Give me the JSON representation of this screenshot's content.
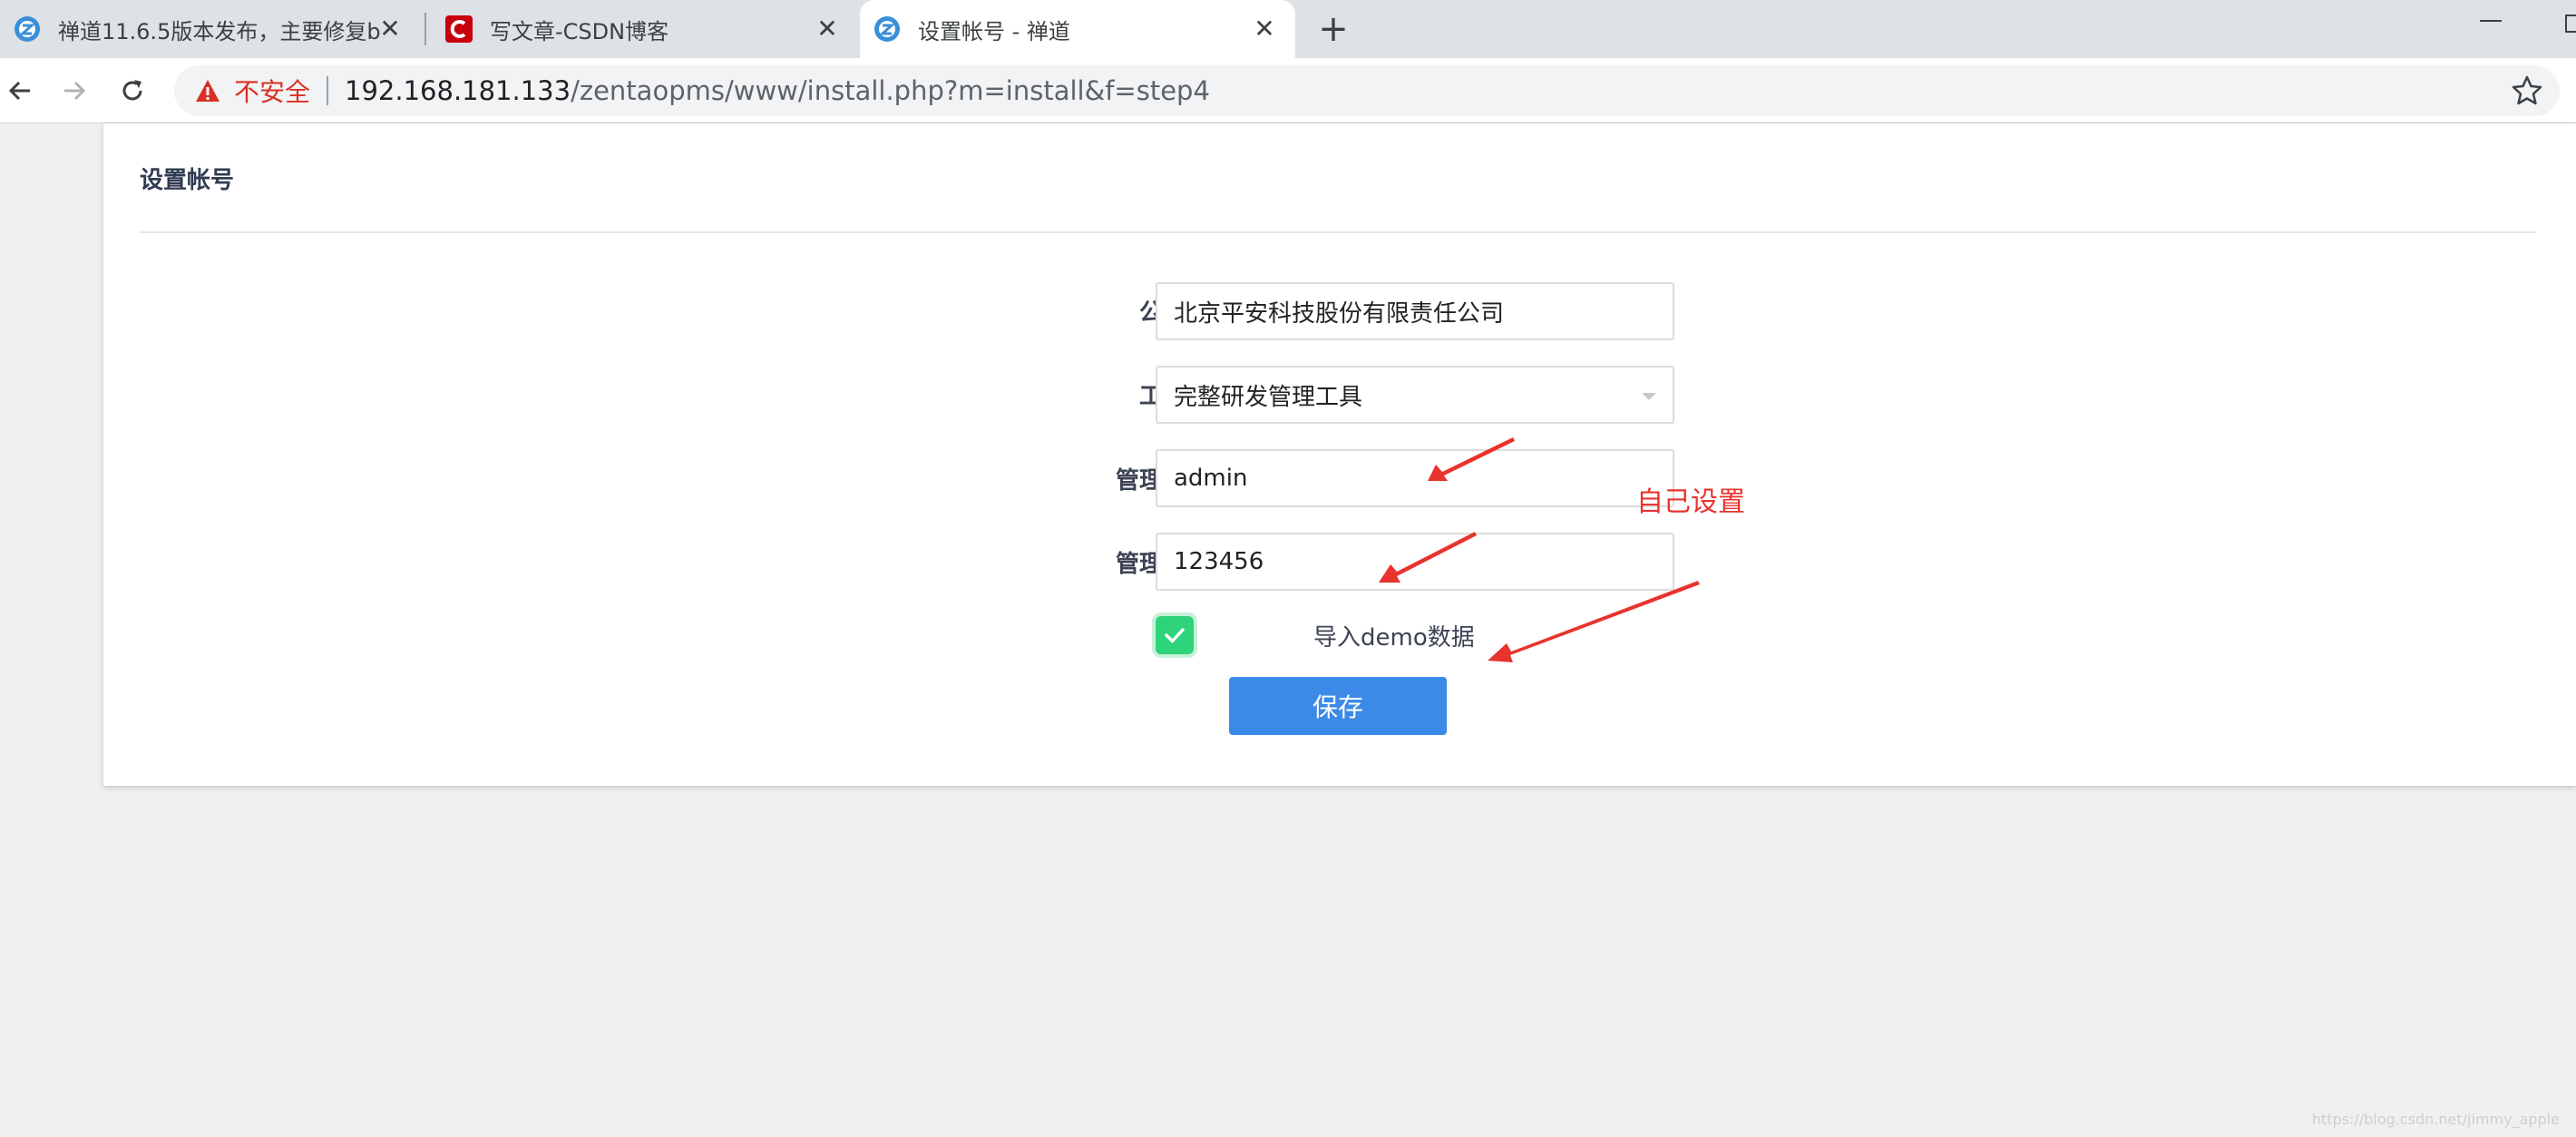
{
  "browser": {
    "tabs": [
      {
        "title": "禅道11.6.5版本发布，主要修复b",
        "favicon": "zentao-icon",
        "active": false
      },
      {
        "title": "写文章-CSDN博客",
        "favicon": "csdn-icon",
        "active": false
      },
      {
        "title": "设置帐号 - 禅道",
        "favicon": "zentao-icon",
        "active": true
      }
    ],
    "new_tab_label": "+",
    "close_glyph": "✕",
    "security_label": "不安全",
    "url_host": "192.168.181.133",
    "url_path": "/zentaopms/www/install.php?m=install&f=step4"
  },
  "page": {
    "title": "设置帐号",
    "form": {
      "company_label": "公司名称",
      "company_value": "北京平安科技股份有限责任公司",
      "work_mode_label": "工作方式",
      "work_mode_value": "完整研发管理工具",
      "admin_account_label": "管理员帐号",
      "admin_account_value": "admin",
      "admin_password_label": "管理员密码",
      "admin_password_value": "123456",
      "import_demo_label": "导入demo数据",
      "import_demo_checked": true,
      "save_label": "保存"
    },
    "annotation_text": "自己设置",
    "watermark": "https://blog.csdn.net/jimmy_apple"
  },
  "colors": {
    "accent": "#3c8ae8",
    "checkbox": "#2fd37a",
    "annotation": "#e8332e",
    "insecure": "#d93025"
  }
}
